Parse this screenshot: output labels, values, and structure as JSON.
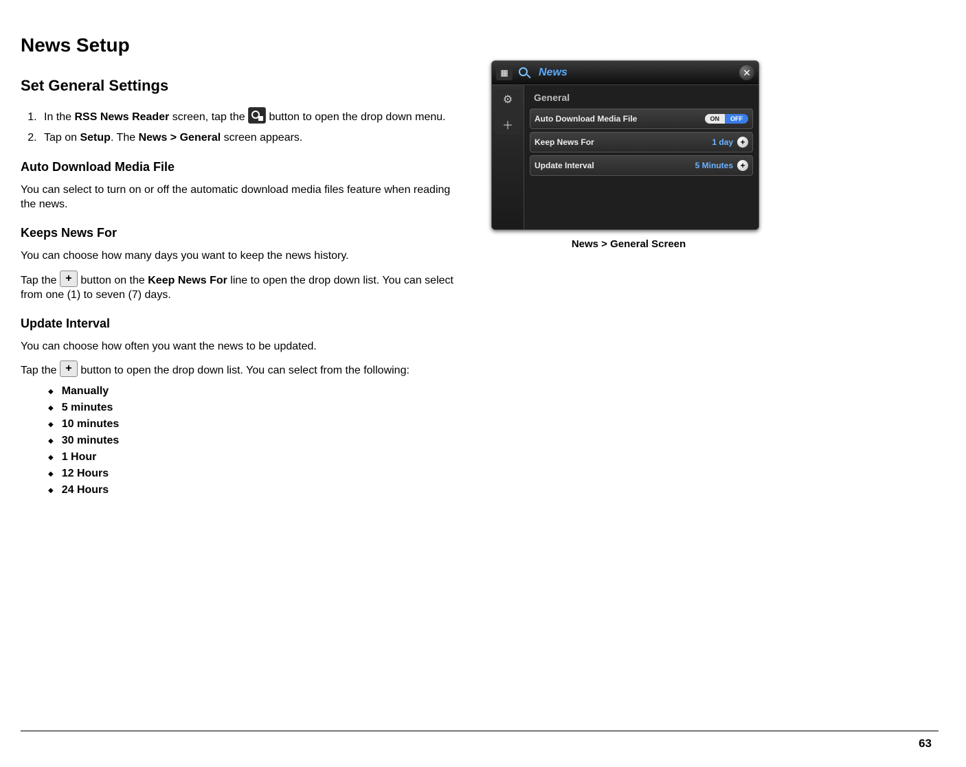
{
  "page": {
    "number": "63"
  },
  "title": "News Setup",
  "section1": {
    "heading": "Set General Settings",
    "steps": [
      {
        "pre": "In the ",
        "b1": "RSS News Reader",
        "mid": " screen, tap the ",
        "post": " button to open the drop down menu."
      },
      {
        "pre": "Tap on ",
        "b1": "Setup",
        "mid": ".  The ",
        "b2": "News > General",
        "post": " screen appears."
      }
    ]
  },
  "auto": {
    "heading": "Auto Download Media File",
    "body": "You can select to turn on or off the automatic download media files feature when reading the news."
  },
  "keep": {
    "heading": "Keeps News For",
    "p1": "You can choose how many days you want to keep the news history.",
    "p2_pre": "Tap the ",
    "p2_mid": " button on the ",
    "p2_b": "Keep News For",
    "p2_post": " line to open the drop down list.  You can select from one (1) to seven (7) days."
  },
  "update": {
    "heading": "Update Interval",
    "p1": "You can choose how often you want the news to be updated.",
    "p2_pre": "Tap the ",
    "p2_post": " button to open the drop down list.  You can select from the following:",
    "options": [
      "Manually",
      "5 minutes",
      "10 minutes",
      "30 minutes",
      "1 Hour",
      "12 Hours",
      "24 Hours"
    ]
  },
  "figure": {
    "app_title": "News",
    "tab": "General",
    "rows": [
      {
        "label": "Auto Download Media File",
        "type": "toggle",
        "on": "ON",
        "off": "OFF"
      },
      {
        "label": "Keep News For",
        "type": "value",
        "value": "1 day"
      },
      {
        "label": "Update Interval",
        "type": "value",
        "value": "5 Minutes"
      }
    ],
    "caption": "News > General Screen"
  }
}
